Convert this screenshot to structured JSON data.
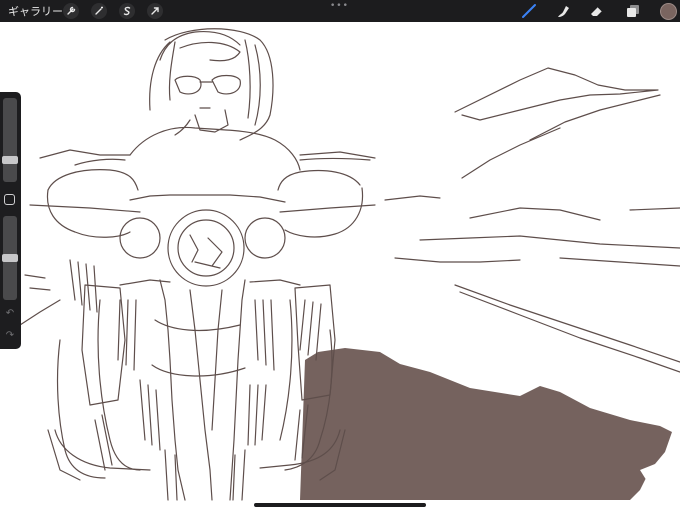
{
  "topbar": {
    "gallery_label": "ギャラリー",
    "left_tools": [
      {
        "icon": "wrench-icon"
      },
      {
        "icon": "magic-wand-icon"
      },
      {
        "icon": "selection-icon"
      },
      {
        "icon": "transform-arrow-icon"
      }
    ],
    "center_handle": "•••",
    "right_tools": [
      {
        "icon": "brush-icon",
        "active": true
      },
      {
        "icon": "smudge-icon"
      },
      {
        "icon": "eraser-icon"
      },
      {
        "icon": "layers-icon"
      }
    ],
    "current_color": "#7a6560"
  },
  "colors": {
    "bar_bg": "#1c1c1e",
    "stroke": "#5e4e4b",
    "fill": "#75625e",
    "active_tool": "#3b82f6"
  },
  "sidebar": {
    "brush_size_level": 0.3,
    "opacity_level": 0.5,
    "undo_symbol": "↶",
    "redo_symbol": "↷"
  }
}
